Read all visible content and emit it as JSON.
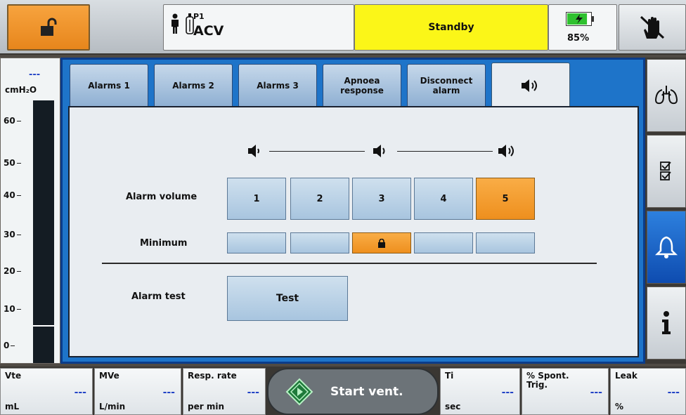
{
  "header": {
    "patient_id": "P1",
    "mode": "ACV",
    "status": "Standby",
    "battery_percent": "85%",
    "battery_level": 0.85,
    "colors": {
      "lock": "#f39a2e",
      "status": "#fbf618",
      "battery": "#2fc12f"
    }
  },
  "pressure": {
    "value": "---",
    "unit": "cmH₂O",
    "ticks": [
      "60",
      "50",
      "40",
      "30",
      "20",
      "10",
      "0"
    ]
  },
  "tabs": [
    {
      "label": "Alarms 1"
    },
    {
      "label": "Alarms 2"
    },
    {
      "label": "Alarms 3"
    },
    {
      "label": "Apnoea\nresponse"
    },
    {
      "label": "Disconnect\nalarm"
    },
    {
      "label": "",
      "icon": "speaker-icon",
      "active": true
    }
  ],
  "alarm_settings": {
    "volume_label": "Alarm volume",
    "volume_levels": [
      "1",
      "2",
      "3",
      "4",
      "5"
    ],
    "selected_volume": "5",
    "minimum_label": "Minimum",
    "minimum_locked_level": "3",
    "test_label": "Alarm test",
    "test_button": "Test"
  },
  "sidenav": [
    {
      "icon": "lungs-icon"
    },
    {
      "icon": "checklist-icon"
    },
    {
      "icon": "bell-icon",
      "active": true
    },
    {
      "icon": "info-icon"
    }
  ],
  "measurements": [
    {
      "label": "Vte",
      "unit": "mL",
      "value": "---"
    },
    {
      "label": "MVe",
      "unit": "L/min",
      "value": "---"
    },
    {
      "label": "Resp. rate",
      "unit": "per min",
      "value": "---"
    },
    {
      "label": "Ti",
      "unit": "sec",
      "value": "---"
    },
    {
      "label": "% Spont.\nTrig.",
      "unit": "",
      "value": "---"
    },
    {
      "label": "Leak",
      "unit": "%",
      "value": "---"
    }
  ],
  "start_button": "Start vent."
}
